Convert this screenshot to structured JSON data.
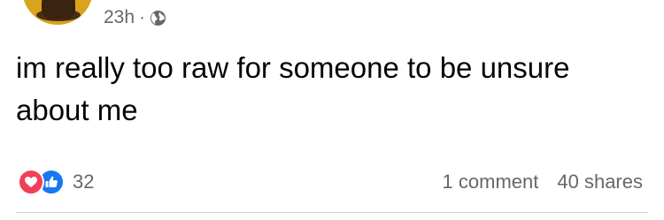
{
  "post": {
    "timestamp": "23h",
    "separator": "·",
    "privacy_icon": "globe-icon",
    "text": "im really too raw for someone to be unsure about me"
  },
  "reactions": {
    "icons": [
      "love-icon",
      "like-icon"
    ],
    "count": "32"
  },
  "stats": {
    "comments": "1 comment",
    "shares": "40 shares"
  },
  "colors": {
    "love": "#f33e58",
    "like": "#1877f2",
    "meta_text": "#65676b",
    "body_text": "#050505",
    "divider": "#ced0d4"
  }
}
